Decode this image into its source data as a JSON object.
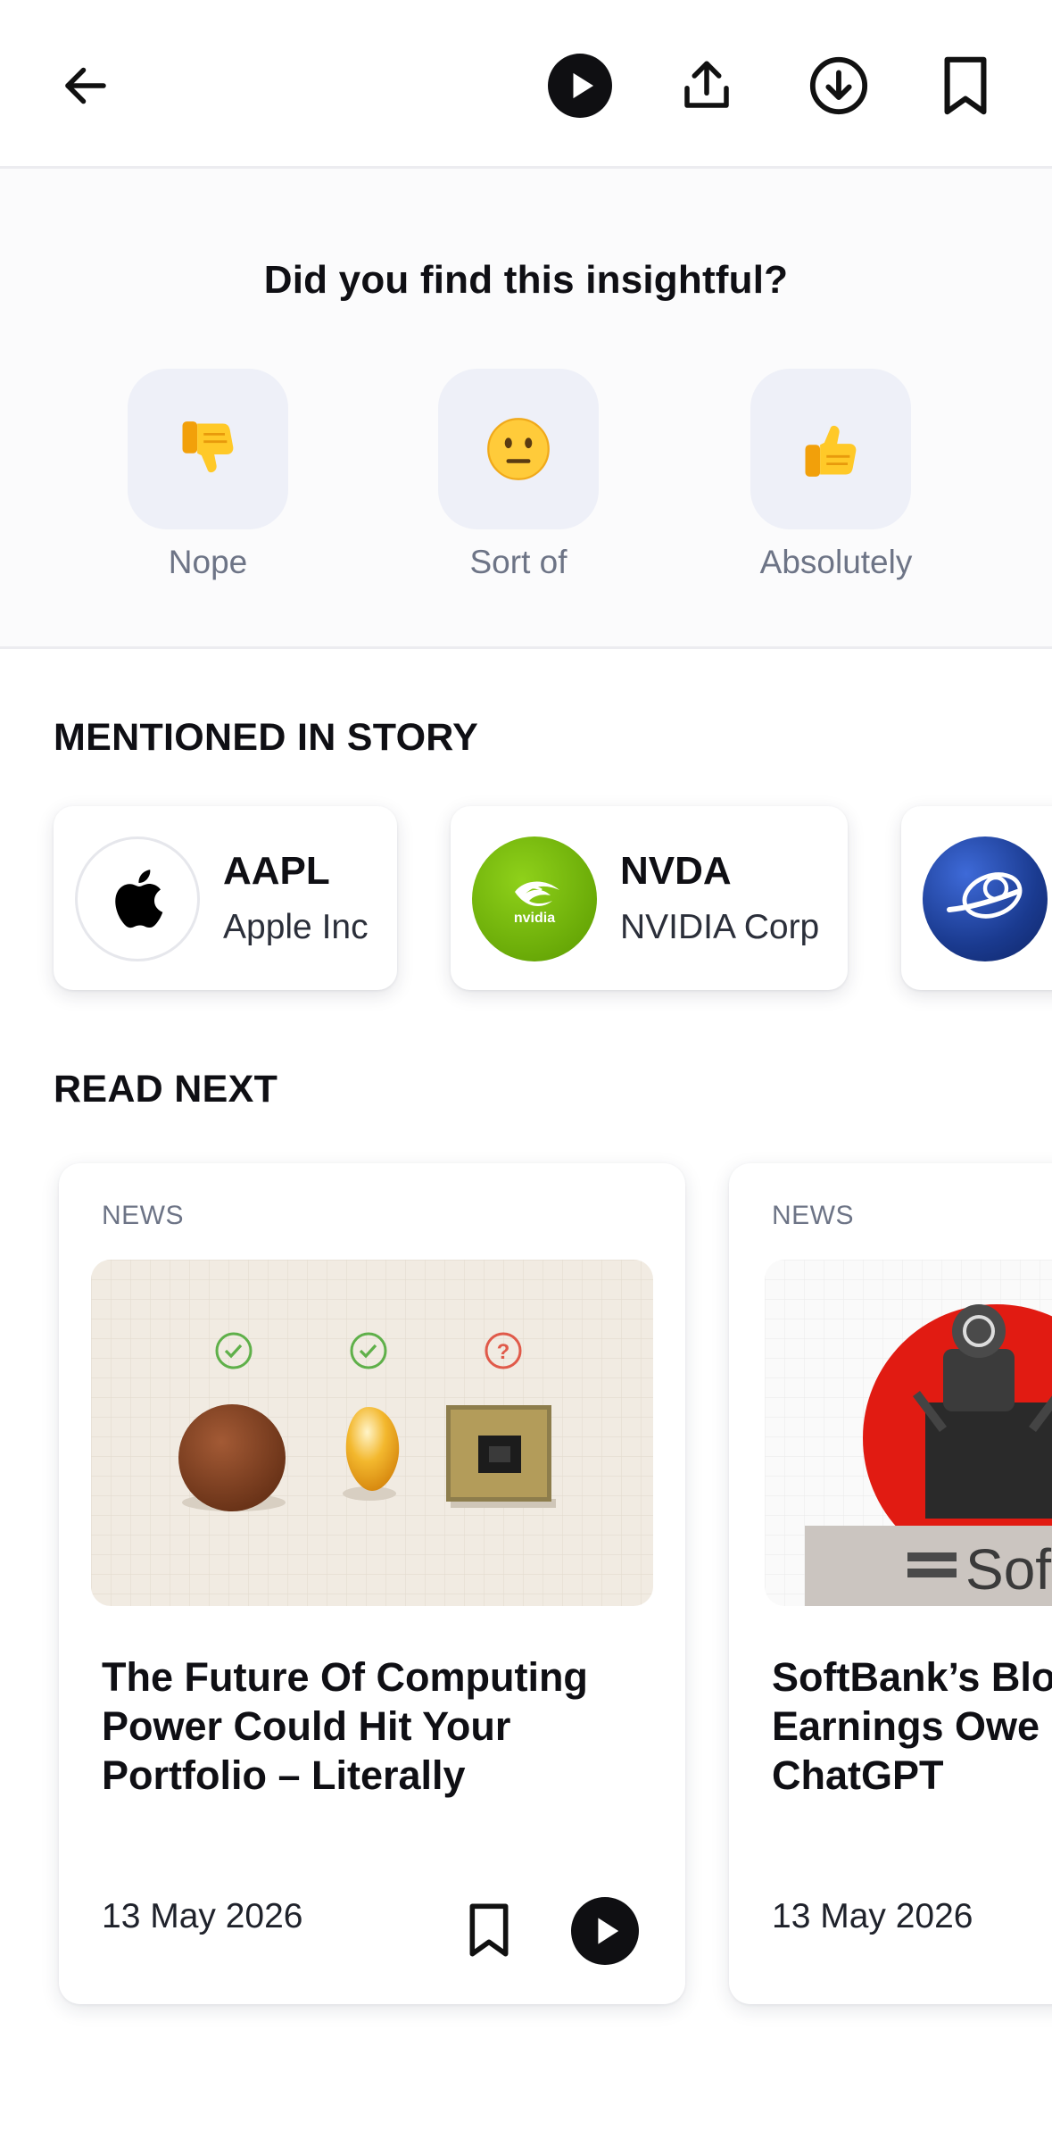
{
  "header": {
    "back_icon": "arrow-left-icon",
    "play_icon": "play-circle-icon",
    "share_icon": "share-icon",
    "download_icon": "download-icon",
    "bookmark_icon": "bookmark-icon"
  },
  "feedback": {
    "question": "Did you find this insightful?",
    "options": [
      {
        "label": "Nope",
        "emoji": "👎",
        "icon": "thumbs-down-icon"
      },
      {
        "label": "Sort of",
        "emoji": "😐",
        "icon": "neutral-face-icon"
      },
      {
        "label": "Absolutely",
        "emoji": "👍",
        "icon": "thumbs-up-icon"
      }
    ]
  },
  "mentioned": {
    "title": "MENTIONED IN STORY",
    "items": [
      {
        "symbol": "AAPL",
        "name": "Apple Inc",
        "logo": "apple-logo"
      },
      {
        "symbol": "NVDA",
        "name": "NVIDIA Corp",
        "logo": "nvidia-logo"
      },
      {
        "symbol": "",
        "name": "",
        "logo": "boeing-logo"
      }
    ]
  },
  "read_next": {
    "title": "READ NEXT",
    "items": [
      {
        "category": "NEWS",
        "title": "The Future Of Computing\nPower Could Hit Your\nPortfolio – Literally",
        "date": "13 May 2026"
      },
      {
        "category": "NEWS",
        "title": "SoftBank’s Blo\nEarnings Owe\nChatGPT",
        "date": "13 May 2026",
        "image_text": "Sof"
      }
    ]
  },
  "colors": {
    "tile_bg": "#eef0f8",
    "muted_text": "#6d7486",
    "nvidia_green": "#76b900",
    "boeing_blue": "#1d439c"
  }
}
